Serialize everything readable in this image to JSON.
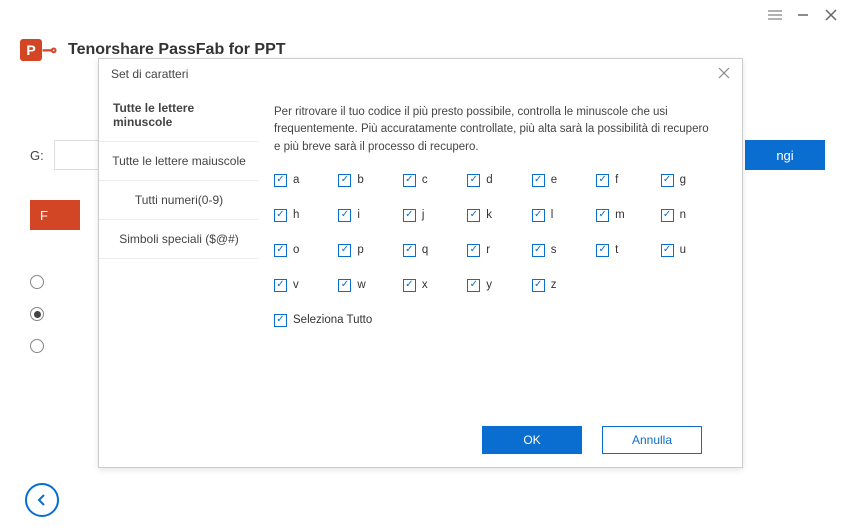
{
  "app": {
    "title": "Tenorshare PassFab for PPT"
  },
  "bg": {
    "label": "G:",
    "btn": "ngi",
    "redbar": "F"
  },
  "dialog": {
    "title": "Set di caratteri",
    "instruction": "Per ritrovare il tuo codice il più presto possibile, controlla le minuscole che usi frequentemente. Più accuratamente controllate, più alta sarà la possibilità di recupero e più breve sarà il processo di recupero.",
    "sidebar": {
      "items": [
        {
          "label": "Tutte le lettere minuscole"
        },
        {
          "label": "Tutte le lettere maiuscole"
        },
        {
          "label": "Tutti numeri(0-9)"
        },
        {
          "label": "Simboli speciali ($@#)"
        }
      ]
    },
    "chars": [
      "a",
      "b",
      "c",
      "d",
      "e",
      "f",
      "g",
      "h",
      "i",
      "j",
      "k",
      "l",
      "m",
      "n",
      "o",
      "p",
      "q",
      "r",
      "s",
      "t",
      "u",
      "v",
      "w",
      "x",
      "y",
      "z"
    ],
    "select_all": "Seleziona Tutto",
    "ok": "OK",
    "cancel": "Annulla"
  }
}
